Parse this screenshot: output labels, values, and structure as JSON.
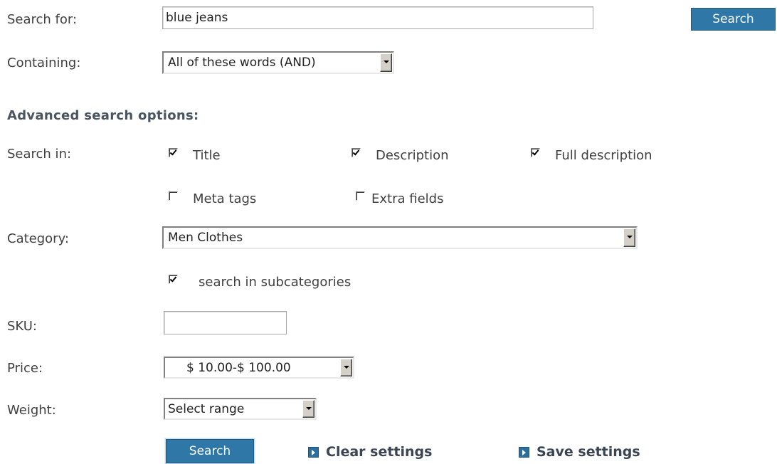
{
  "search_for": {
    "label": "Search for:",
    "value": "blue jeans",
    "button": "Search"
  },
  "containing": {
    "label": "Containing:",
    "value": "All of these words (AND)"
  },
  "advanced": {
    "heading": "Advanced search options:"
  },
  "search_in": {
    "label": "Search in:",
    "options": [
      {
        "label": "Title",
        "checked": true
      },
      {
        "label": "Description",
        "checked": true
      },
      {
        "label": "Full description",
        "checked": true
      },
      {
        "label": "Meta tags",
        "checked": false
      },
      {
        "label": "Extra fields",
        "checked": false
      }
    ]
  },
  "category": {
    "label": "Category:",
    "value": "Men Clothes",
    "subcategories_label": "search in subcategories",
    "subcategories_checked": true
  },
  "sku": {
    "label": "SKU:",
    "value": ""
  },
  "price": {
    "label": "Price:",
    "value": "$ 10.00-$ 100.00"
  },
  "weight": {
    "label": "Weight:",
    "value": "Select range"
  },
  "actions": {
    "search_button": "Search",
    "clear_link": "Clear settings",
    "save_link": "Save settings"
  }
}
